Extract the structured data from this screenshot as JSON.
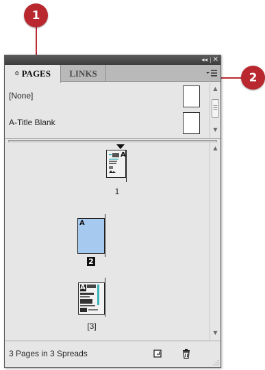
{
  "callouts": {
    "first": "1",
    "second": "2"
  },
  "panel": {
    "collapse_glyph": "◂◂",
    "close_glyph": "✕",
    "tabs": [
      {
        "label": "PAGES",
        "arrow": "≎",
        "active": true
      },
      {
        "label": "LINKS",
        "active": false
      }
    ]
  },
  "masters": [
    {
      "label": "[None]"
    },
    {
      "label": "A-Title Blank"
    }
  ],
  "pages": [
    {
      "prefix": "A",
      "number": "1",
      "selected": false,
      "highlighted": false
    },
    {
      "prefix": "A",
      "number": "2",
      "selected": true,
      "highlighted": true
    },
    {
      "prefix": "A",
      "number": "[3]",
      "selected": false,
      "highlighted": false
    }
  ],
  "status": {
    "text": "3 Pages in 3 Spreads"
  },
  "icons": [
    "panel-menu-icon",
    "new-page-icon",
    "delete-page-icon",
    "resize-grip-icon"
  ],
  "colors": {
    "callout": "#b8282e",
    "selected_page": "#a6c9ef",
    "panel_bg": "#e6e6e6",
    "tab_bar": "#b9b9b9"
  }
}
